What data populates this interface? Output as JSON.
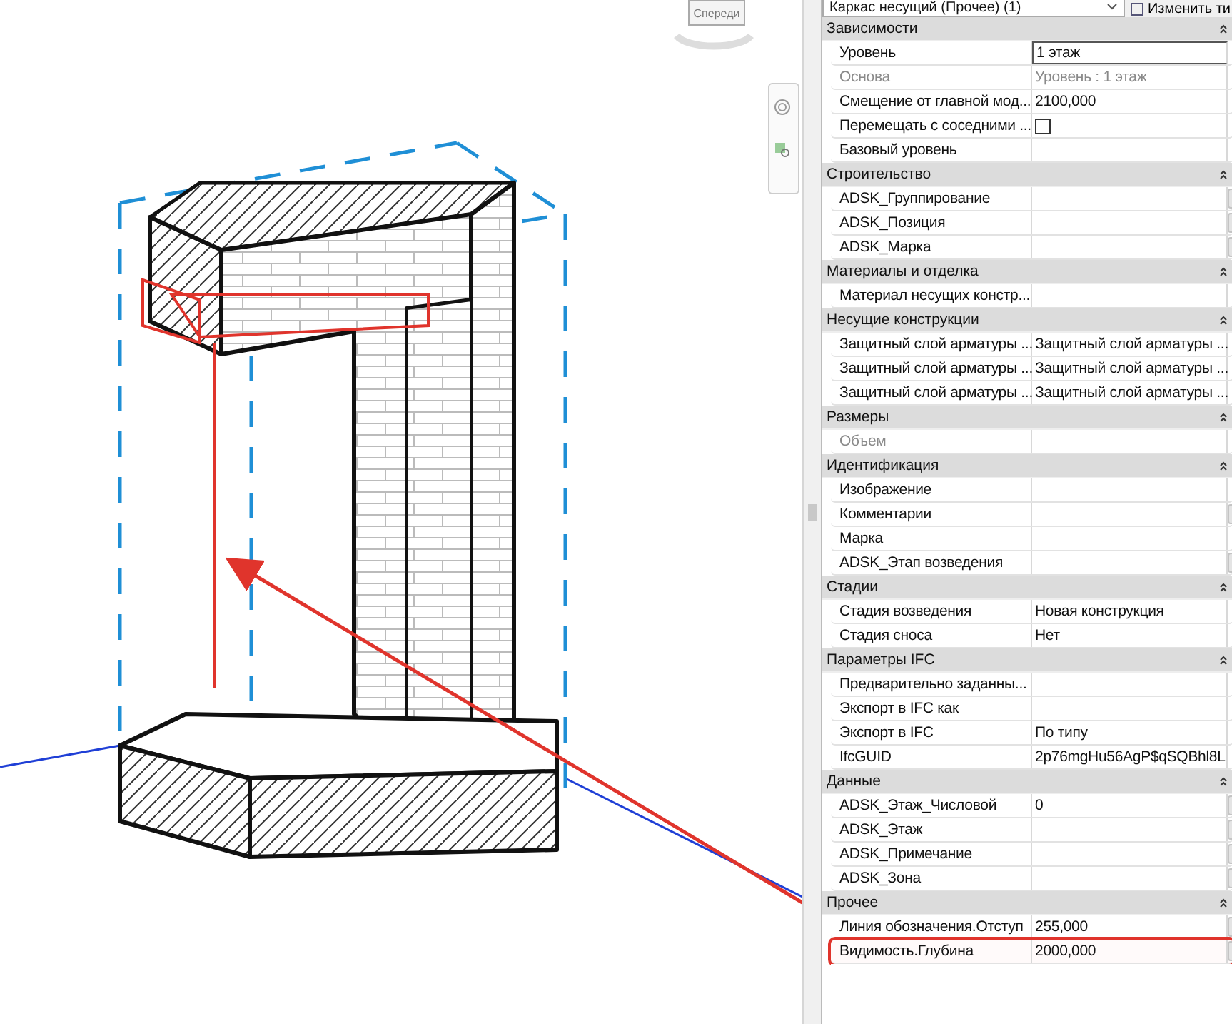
{
  "viewport": {
    "viewcube_label": "Спереди"
  },
  "properties": {
    "type_selector": "Каркас несущий (Прочее) (1)",
    "edit_type_button": "Изменить ти",
    "groups": [
      {
        "title": "Зависимости",
        "expanded": true,
        "rows": [
          {
            "kind": "text",
            "label": "Уровень",
            "value": "1 этаж",
            "disabled": false,
            "editing": true,
            "button": false,
            "highlighted": false
          },
          {
            "kind": "text",
            "label": "Основа",
            "value": "Уровень : 1 этаж",
            "disabled": true,
            "editing": false,
            "button": false,
            "highlighted": false
          },
          {
            "kind": "text",
            "label": "Смещение от главной мод...",
            "value": "2100,000",
            "disabled": false,
            "editing": false,
            "button": false,
            "highlighted": false
          },
          {
            "kind": "checkbox",
            "label": "Перемещать с соседними ...",
            "checked": false,
            "disabled": false,
            "editing": false,
            "button": false,
            "highlighted": false
          },
          {
            "kind": "text",
            "label": "Базовый уровень",
            "disabled": false,
            "editing": false,
            "button": false,
            "highlighted": false
          }
        ]
      },
      {
        "title": "Строительство",
        "expanded": true,
        "rows": [
          {
            "kind": "text",
            "label": "ADSK_Группирование",
            "disabled": false,
            "editing": false,
            "button": true,
            "highlighted": false
          },
          {
            "kind": "text",
            "label": "ADSK_Позиция",
            "disabled": false,
            "editing": false,
            "button": true,
            "highlighted": false
          },
          {
            "kind": "text",
            "label": "ADSK_Марка",
            "disabled": false,
            "editing": false,
            "button": true,
            "highlighted": false
          }
        ]
      },
      {
        "title": "Материалы и отделка",
        "expanded": true,
        "rows": [
          {
            "kind": "text",
            "label": "Материал несущих констр...",
            "disabled": false,
            "editing": false,
            "button": false,
            "highlighted": false
          }
        ]
      },
      {
        "title": "Несущие конструкции",
        "expanded": true,
        "rows": [
          {
            "kind": "text",
            "label": "Защитный слой арматуры ...",
            "value": "Защитный слой арматуры ...",
            "disabled": false,
            "editing": false,
            "button": false,
            "highlighted": false
          },
          {
            "kind": "text",
            "label": "Защитный слой арматуры ...",
            "value": "Защитный слой арматуры ...",
            "disabled": false,
            "editing": false,
            "button": false,
            "highlighted": false
          },
          {
            "kind": "text",
            "label": "Защитный слой арматуры ...",
            "value": "Защитный слой арматуры ...",
            "disabled": false,
            "editing": false,
            "button": false,
            "highlighted": false
          }
        ]
      },
      {
        "title": "Размеры",
        "expanded": true,
        "rows": [
          {
            "kind": "text",
            "label": "Объем",
            "disabled": true,
            "editing": false,
            "button": false,
            "highlighted": false
          }
        ]
      },
      {
        "title": "Идентификация",
        "expanded": true,
        "rows": [
          {
            "kind": "text",
            "label": "Изображение",
            "disabled": false,
            "editing": false,
            "button": false,
            "highlighted": false
          },
          {
            "kind": "text",
            "label": "Комментарии",
            "disabled": false,
            "editing": false,
            "button": true,
            "highlighted": false
          },
          {
            "kind": "text",
            "label": "Марка",
            "disabled": false,
            "editing": false,
            "button": false,
            "highlighted": false
          },
          {
            "kind": "text",
            "label": "ADSK_Этап возведения",
            "disabled": false,
            "editing": false,
            "button": true,
            "highlighted": false
          }
        ]
      },
      {
        "title": "Стадии",
        "expanded": true,
        "rows": [
          {
            "kind": "text",
            "label": "Стадия возведения",
            "value": "Новая конструкция",
            "disabled": false,
            "editing": false,
            "button": false,
            "highlighted": false
          },
          {
            "kind": "text",
            "label": "Стадия сноса",
            "value": "Нет",
            "disabled": false,
            "editing": false,
            "button": false,
            "highlighted": false
          }
        ]
      },
      {
        "title": "Параметры IFC",
        "expanded": true,
        "rows": [
          {
            "kind": "text",
            "label": "Предварительно заданны...",
            "disabled": false,
            "editing": false,
            "button": false,
            "highlighted": false
          },
          {
            "kind": "text",
            "label": "Экспорт в IFC как",
            "disabled": false,
            "editing": false,
            "button": false,
            "highlighted": false
          },
          {
            "kind": "text",
            "label": "Экспорт в IFC",
            "value": "По типу",
            "disabled": false,
            "editing": false,
            "button": false,
            "highlighted": false
          },
          {
            "kind": "text",
            "label": "IfcGUID",
            "value": "2p76mgHu56AgP$qSQBhl8L",
            "disabled": false,
            "editing": false,
            "button": false,
            "highlighted": false
          }
        ]
      },
      {
        "title": "Данные",
        "expanded": true,
        "rows": [
          {
            "kind": "text",
            "label": "ADSK_Этаж_Числовой",
            "value": "0",
            "disabled": false,
            "editing": false,
            "button": true,
            "highlighted": false
          },
          {
            "kind": "text",
            "label": "ADSK_Этаж",
            "disabled": false,
            "editing": false,
            "button": true,
            "highlighted": false
          },
          {
            "kind": "text",
            "label": "ADSK_Примечание",
            "disabled": false,
            "editing": false,
            "button": true,
            "highlighted": false
          },
          {
            "kind": "text",
            "label": "ADSK_Зона",
            "disabled": false,
            "editing": false,
            "button": true,
            "highlighted": false
          }
        ]
      },
      {
        "title": "Прочее",
        "expanded": true,
        "rows": [
          {
            "kind": "text",
            "label": "Линия обозначения.Отступ",
            "value": "255,000",
            "disabled": false,
            "editing": false,
            "button": true,
            "highlighted": false
          },
          {
            "kind": "text",
            "label": "Видимость.Глубина",
            "value": "2000,000",
            "disabled": false,
            "editing": false,
            "button": true,
            "highlighted": true
          }
        ]
      }
    ]
  }
}
